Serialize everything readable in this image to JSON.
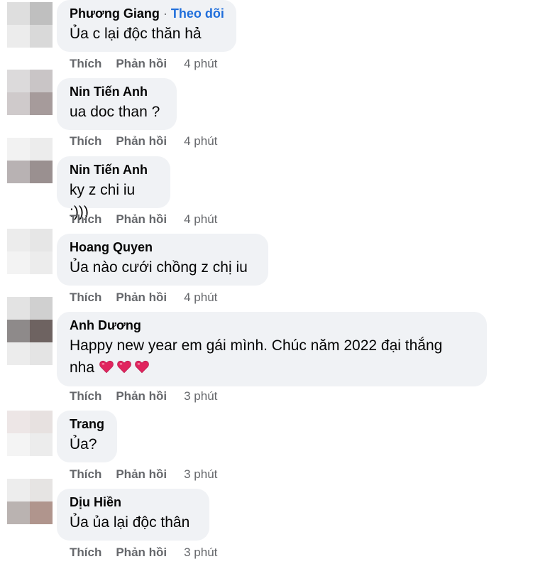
{
  "labels": {
    "like": "Thích",
    "reply": "Phản hồi",
    "follow": "Theo dõi",
    "dot": "·"
  },
  "comments": [
    {
      "author": "Phương Giang",
      "text": "Ủa c lại độc thăn hả",
      "time": "4 phút",
      "follow": true
    },
    {
      "author": "Nin Tiến Anh",
      "text": "ua doc than ?",
      "time": "4 phút"
    },
    {
      "author": "Nin Tiến Anh",
      "text": "ky z chi iu :)))",
      "time": "4 phút"
    },
    {
      "author": "Hoang Quyen",
      "text": "Ủa nào cưới chồng z chị iu",
      "time": "4 phút"
    },
    {
      "author": "Anh Dương",
      "text": "Happy new year em gái mình. Chúc năm 2022 đại thắng",
      "text2": "nha",
      "emoji": [
        "heart-emoji",
        "heart-emoji",
        "heart-emoji"
      ],
      "time": "3 phút"
    },
    {
      "author": "Trang",
      "text": "Ủa?",
      "time": "3 phút"
    },
    {
      "author": "Dịu Hiền",
      "text": "Ủa ủa lại độc thân",
      "time": "3 phút"
    }
  ],
  "colors": {
    "bubble": "#f0f2f5",
    "follow_link": "#216fdb",
    "meta_text": "#65676b",
    "heart": "#e0245e"
  }
}
